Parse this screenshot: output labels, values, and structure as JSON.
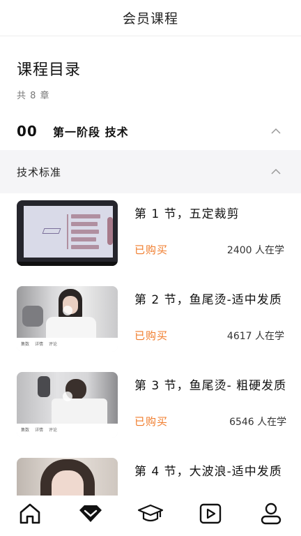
{
  "header": {
    "title": "会员课程"
  },
  "catalog": {
    "title": "课程目录",
    "count": "共 8 章"
  },
  "stage": {
    "number": "00",
    "name": "第一阶段  技术"
  },
  "section": {
    "name": "技术标准"
  },
  "lessons": [
    {
      "title": "第 1 节，五定裁剪",
      "status": "已购买",
      "learners": "2400 人在学",
      "thumbnail": "mindmap-slide"
    },
    {
      "title": "第 2 节，鱼尾烫-适中发质",
      "status": "已购买",
      "learners": "4617 人在学",
      "thumbnail": "salon-photo"
    },
    {
      "title": "第 3 节，鱼尾烫- 粗硬发质",
      "status": "已购买",
      "learners": "6546 人在学",
      "thumbnail": "salon-photo"
    },
    {
      "title": "第 4 节，大波浪-适中发质",
      "status": "",
      "learners": "",
      "thumbnail": "portrait-photo"
    }
  ],
  "thumb_tabs": [
    "集数",
    "详情",
    "评论"
  ],
  "tabbar": {
    "items": [
      "home-icon",
      "vip-diamond-icon",
      "graduation-cap-icon",
      "video-play-icon",
      "profile-icon"
    ],
    "active_index": 1
  },
  "colors": {
    "accent": "#f07b2a",
    "section_bg": "#f5f5f7",
    "text": "#111111"
  }
}
